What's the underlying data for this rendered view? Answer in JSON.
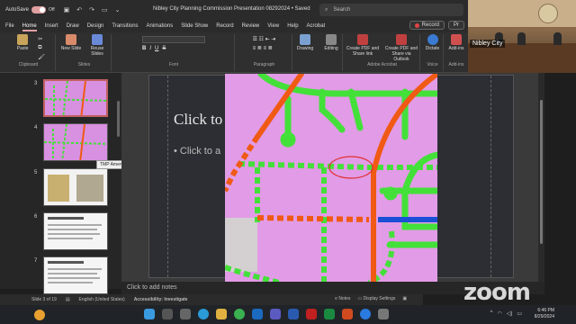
{
  "window": {
    "autosave_label": "AutoSave",
    "autosave_state": "Off",
    "doc_title": "Nibley City Planning Commission Presentation 08292024 • Saved",
    "search_placeholder": "Search"
  },
  "menu": {
    "tabs": [
      "File",
      "Home",
      "Insert",
      "Draw",
      "Design",
      "Transitions",
      "Animations",
      "Slide Show",
      "Record",
      "Review",
      "View",
      "Help",
      "Acrobat"
    ],
    "active_tab": "Home",
    "record_label": "Record",
    "present_label": "Pr"
  },
  "ribbon": {
    "groups": {
      "clipboard": "Clipboard",
      "slides": "Slides",
      "font": "Font",
      "paragraph": "Paragraph",
      "adobe": "Adobe Acrobat",
      "voice": "Voice",
      "addins": "Add-ins"
    },
    "buttons": {
      "paste": "Paste",
      "new_slide": "New Slide",
      "reuse_slides": "Reuse Slides",
      "drawing": "Drawing",
      "editing": "Editing",
      "create_pdf_share": "Create PDF and Share link",
      "create_pdf_outlook": "Create PDF and Share via Outlook",
      "dictate": "Dictate",
      "addins": "Add-ins"
    }
  },
  "webcam": {
    "participant_name": "Nibley City"
  },
  "slides_panel": {
    "numbers": [
      "3",
      "4",
      "5",
      "6",
      "7"
    ],
    "selected": "3",
    "tooltip": "TMP Amendment Request – 2500 ..."
  },
  "slide": {
    "title": "Click to",
    "bullet": "• Click to a"
  },
  "notes": {
    "placeholder": "Click to add notes"
  },
  "status": {
    "slide_count": "Slide 3 of 19",
    "language": "English (United States)",
    "accessibility": "Accessibility: Investigate",
    "notes": "Notes",
    "display_settings": "Display Settings"
  },
  "zoom_logo": "zoom",
  "taskbar": {
    "time": "6:46 PM",
    "date": "8/29/2024"
  },
  "colors": {
    "map_pink": "#e29be6",
    "road_green": "#44e03a",
    "road_orange": "#f05a14",
    "road_blue": "#1a4fd6",
    "accent": "#e0a0a0"
  }
}
